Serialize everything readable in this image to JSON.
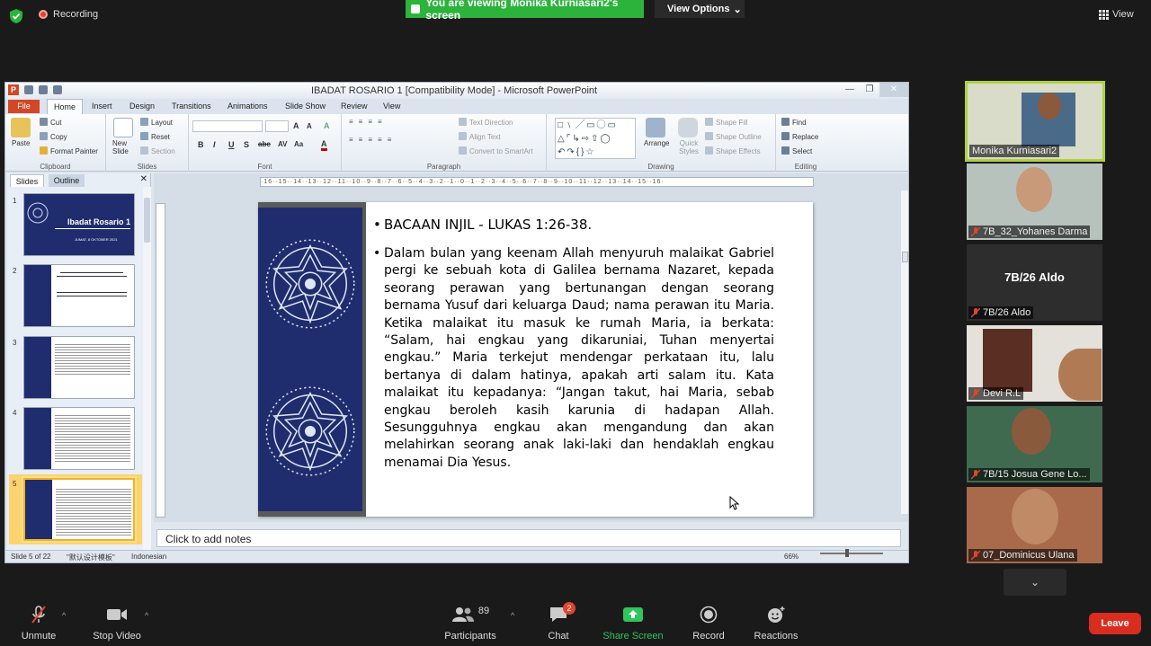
{
  "zoom": {
    "recording_label": "Recording",
    "viewing_banner": "You are viewing Monika Kurniasari2's screen",
    "view_options_label": "View Options",
    "view_label": "View",
    "shield_color": "#2bb33b",
    "toolbar": {
      "unmute": "Unmute",
      "stop_video": "Stop Video",
      "participants": "Participants",
      "participants_count": "89",
      "chat": "Chat",
      "chat_badge": "2",
      "share_screen": "Share Screen",
      "record": "Record",
      "reactions": "Reactions",
      "leave": "Leave"
    },
    "participants": [
      {
        "name": "Monika Kurniasari2",
        "muted": false,
        "active": true
      },
      {
        "name": "7B_32_Yohanes Darma",
        "muted": true
      },
      {
        "name": "7B/26 Aldo",
        "muted": true,
        "video_off": true,
        "display_name": "7B/26 Aldo"
      },
      {
        "name": "Devi R.L",
        "muted": true
      },
      {
        "name": "7B/15 Josua Gene Lo...",
        "muted": true
      },
      {
        "name": "07_Dominicus Ulana",
        "muted": true
      }
    ]
  },
  "ppt": {
    "window_title": "IBADAT ROSARIO 1 [Compatibility Mode]  -  Microsoft PowerPoint",
    "tabs": [
      "File",
      "Home",
      "Insert",
      "Design",
      "Transitions",
      "Animations",
      "Slide Show",
      "Review",
      "View"
    ],
    "ribbon": {
      "clipboard": {
        "label": "Clipboard",
        "paste": "Paste",
        "cut": "Cut",
        "copy": "Copy",
        "format_painter": "Format Painter"
      },
      "slides": {
        "label": "Slides",
        "new_slide": "New Slide",
        "layout": "Layout",
        "reset": "Reset",
        "section": "Section"
      },
      "font": {
        "label": "Font"
      },
      "paragraph": {
        "label": "Paragraph",
        "text_direction": "Text Direction",
        "align_text": "Align Text",
        "convert_smartart": "Convert to SmartArt"
      },
      "drawing": {
        "label": "Drawing",
        "arrange": "Arrange",
        "quick_styles": "Quick Styles",
        "shape_fill": "Shape Fill",
        "shape_outline": "Shape Outline",
        "shape_effects": "Shape Effects"
      },
      "editing": {
        "label": "Editing",
        "find": "Find",
        "replace": "Replace",
        "select": "Select"
      }
    },
    "left_pane": {
      "tab_slides": "Slides",
      "tab_outline": "Outline",
      "slide_numbers": [
        "1",
        "2",
        "3",
        "4",
        "5"
      ],
      "thumb1_title": "Ibadat Rosario 1",
      "thumb1_date": "JUMAT, 8 OKTOBER 2021"
    },
    "slide": {
      "heading": "BACAAN INJIL - LUKAS 1:26-38.",
      "body": "Dalam bulan yang keenam Allah menyuruh malaikat Gabriel pergi ke sebuah kota di Galilea bernama Nazaret, kepada seorang perawan yang bertunangan dengan seorang bernama Yusuf dari keluarga Daud; nama perawan itu Maria. Ketika malaikat itu masuk ke rumah Maria, ia berkata: “Salam, hai engkau yang dikaruniai, Tuhan menyertai engkau.” Maria terkejut mendengar perkataan itu, lalu bertanya di dalam hatinya, apakah arti salam itu. Kata malaikat itu kepadanya: “Jangan takut, hai Maria, sebab engkau beroleh kasih karunia di hadapan Allah. Sesungguhnya engkau akan mengandung dan akan melahirkan seorang anak laki-laki dan hendaklah engkau menamai Dia Yesus.",
      "band_color": "#1f2d6e"
    },
    "ruler_text": "·16··15··14··13··12··11··10··9··8··7··6··5··4··3··2··1··0··1··2··3··4··5··6··7··8··9··10··11··12··13··14··15··16·",
    "notes_placeholder": "Click to add notes",
    "status": {
      "slide_of": "Slide 5 of 22",
      "theme": "\"默认设计模板\"",
      "language": "Indonesian",
      "zoom": "66%"
    }
  }
}
